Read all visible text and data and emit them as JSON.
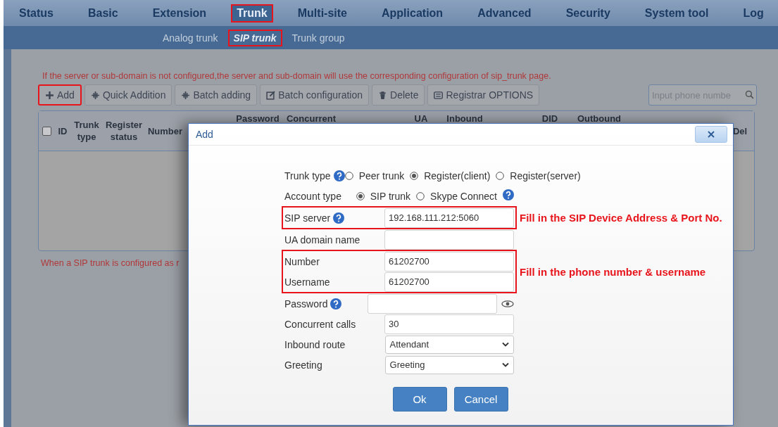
{
  "nav": [
    {
      "label": "Status",
      "selected": false,
      "annotated": false
    },
    {
      "label": "Basic",
      "selected": false,
      "annotated": false
    },
    {
      "label": "Extension",
      "selected": false,
      "annotated": false
    },
    {
      "label": "Trunk",
      "selected": true,
      "annotated": true
    },
    {
      "label": "Multi-site",
      "selected": false,
      "annotated": false
    },
    {
      "label": "Application",
      "selected": false,
      "annotated": false
    },
    {
      "label": "Advanced",
      "selected": false,
      "annotated": false
    },
    {
      "label": "Security",
      "selected": false,
      "annotated": false
    },
    {
      "label": "System tool",
      "selected": false,
      "annotated": false
    },
    {
      "label": "Log",
      "selected": false,
      "annotated": false
    }
  ],
  "subnav": [
    {
      "label": "Analog trunk",
      "selected": false,
      "annotated": false
    },
    {
      "label": "SIP trunk",
      "selected": true,
      "annotated": true
    },
    {
      "label": "Trunk group",
      "selected": false,
      "annotated": false
    }
  ],
  "notice": "If the server or sub-domain is not configured,the server and sub-domain will use the corresponding configuration of sip_trunk page.",
  "toolbar": [
    {
      "label": "Add",
      "annotated": true
    },
    {
      "label": "Quick Addition",
      "annotated": false
    },
    {
      "label": "Batch adding",
      "annotated": false
    },
    {
      "label": "Batch configuration",
      "annotated": false
    },
    {
      "label": "Delete",
      "annotated": false
    },
    {
      "label": "Registrar OPTIONS",
      "annotated": false
    }
  ],
  "search": {
    "placeholder": "Input phone numbe"
  },
  "table": {
    "select_all": false,
    "columns": [
      "ID",
      "Trunk type",
      "Register status",
      "Number",
      "Password",
      "Concurrent",
      "UA",
      "Inbound",
      "DID",
      "Outbound",
      "Del"
    ]
  },
  "footnote": "When a SIP trunk is configured as r",
  "dialog": {
    "title": "Add",
    "sections": [
      {
        "annotated": false,
        "rows": [
          {
            "kind": "radio",
            "label": "Trunk type",
            "help": true,
            "options": [
              {
                "label": "Peer trunk",
                "selected": false
              },
              {
                "label": "Register(client)",
                "selected": true
              },
              {
                "label": "Register(server)",
                "selected": false
              }
            ]
          },
          {
            "kind": "radio",
            "label": "Account type",
            "help": false,
            "options": [
              {
                "label": "SIP trunk",
                "selected": true
              },
              {
                "label": "Skype Connect",
                "selected": false
              }
            ],
            "trailing_help": true
          }
        ]
      },
      {
        "annotated": true,
        "note": "Fill in the SIP Device Address & Port No.",
        "rows": [
          {
            "kind": "text",
            "label": "SIP server",
            "help": true,
            "value": "192.168.111.212:5060"
          }
        ]
      },
      {
        "annotated": false,
        "rows": [
          {
            "kind": "text",
            "label": "UA domain name",
            "help": false
          }
        ]
      },
      {
        "annotated": true,
        "note": "Fill in the phone number & username",
        "rows": [
          {
            "kind": "text",
            "label": "Number",
            "help": false,
            "value": "61202700"
          },
          {
            "kind": "text",
            "label": "Username",
            "help": false,
            "value": "61202700"
          }
        ]
      },
      {
        "annotated": false,
        "rows": [
          {
            "kind": "password",
            "label": "Password",
            "help": true
          },
          {
            "kind": "text",
            "label": "Concurrent calls",
            "help": false,
            "value": "30"
          },
          {
            "kind": "select",
            "label": "Inbound route",
            "help": false,
            "value": "Attendant"
          },
          {
            "kind": "select",
            "label": "Greeting",
            "help": false,
            "value": "Greeting"
          }
        ]
      }
    ],
    "buttons": [
      "Ok",
      "Cancel"
    ]
  }
}
